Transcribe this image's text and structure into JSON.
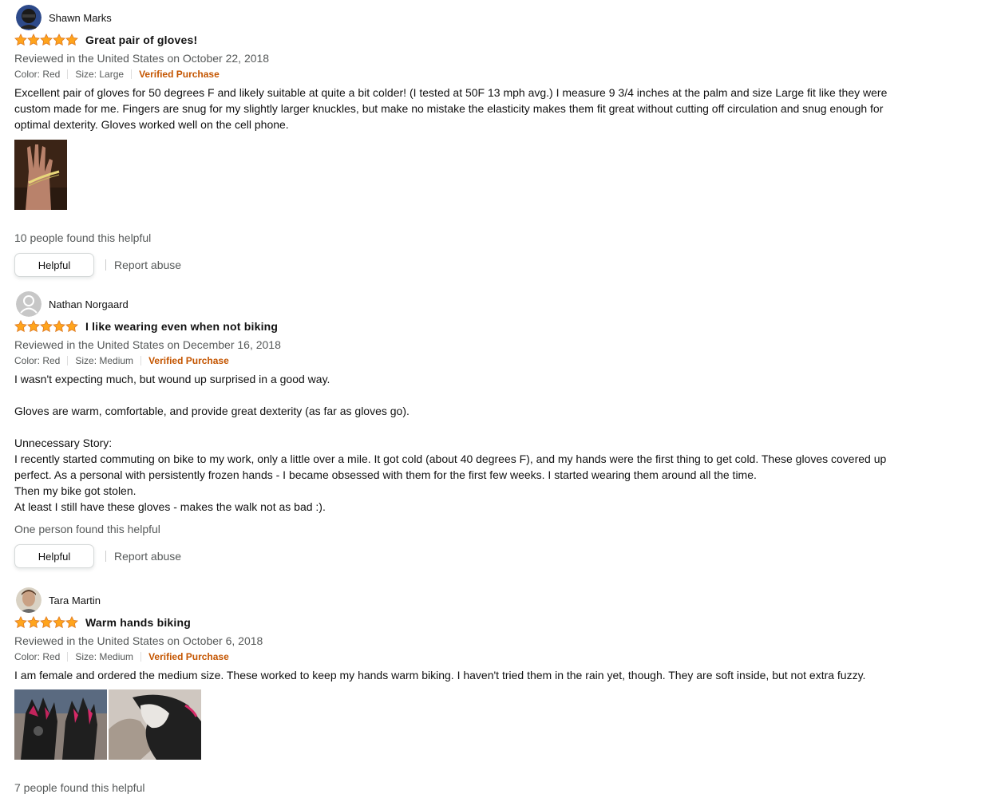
{
  "reviews": [
    {
      "author": "Shawn Marks",
      "rating": 5,
      "title": "Great pair of gloves!",
      "date": "Reviewed in the United States on October 22, 2018",
      "color": "Color: Red",
      "size": "Size: Large",
      "verified": "Verified Purchase",
      "body": [
        "Excellent pair of gloves for 50 degrees F and likely suitable at quite a bit colder! (I tested at 50F 13 mph avg.) I measure 9 3/4 inches at the palm and size Large fit like they were custom made for me. Fingers are snug for my slightly larger knuckles, but make no mistake the elasticity makes them fit great without cutting off circulation and snug enough for optimal dexterity. Gloves worked well on the cell phone."
      ],
      "helpful_count": "10 people found this helpful",
      "helpful_label": "Helpful",
      "report_label": "Report abuse"
    },
    {
      "author": "Nathan Norgaard",
      "rating": 5,
      "title": "I like wearing even when not biking",
      "date": "Reviewed in the United States on December 16, 2018",
      "color": "Color: Red",
      "size": "Size: Medium",
      "verified": "Verified Purchase",
      "body": [
        "I wasn't expecting much, but wound up surprised in a good way.",
        "",
        "Gloves are warm, comfortable, and provide great dexterity (as far as gloves go).",
        "",
        "Unnecessary Story:",
        "I recently started commuting on bike to my work, only a little over a mile. It got cold (about 40 degrees F), and my hands were the first thing to get cold. These gloves covered up perfect. As a personal with persistently frozen hands - I became obsessed with them for the first few weeks. I started wearing them around all the time.",
        "Then my bike got stolen.",
        "At least I still have these gloves - makes the walk not as bad :)."
      ],
      "helpful_count": "One person found this helpful",
      "helpful_label": "Helpful",
      "report_label": "Report abuse"
    },
    {
      "author": "Tara Martin",
      "rating": 5,
      "title": "Warm hands biking",
      "date": "Reviewed in the United States on October 6, 2018",
      "color": "Color: Red",
      "size": "Size: Medium",
      "verified": "Verified Purchase",
      "body": [
        "I am female and ordered the medium size. These worked to keep my hands warm biking. I haven't tried them in the rain yet, though. They are soft inside, but not extra fuzzy."
      ],
      "helpful_count": "7 people found this helpful"
    }
  ],
  "colors": {
    "star": "#ffa41c",
    "verified": "#c45500",
    "muted": "#565959"
  }
}
